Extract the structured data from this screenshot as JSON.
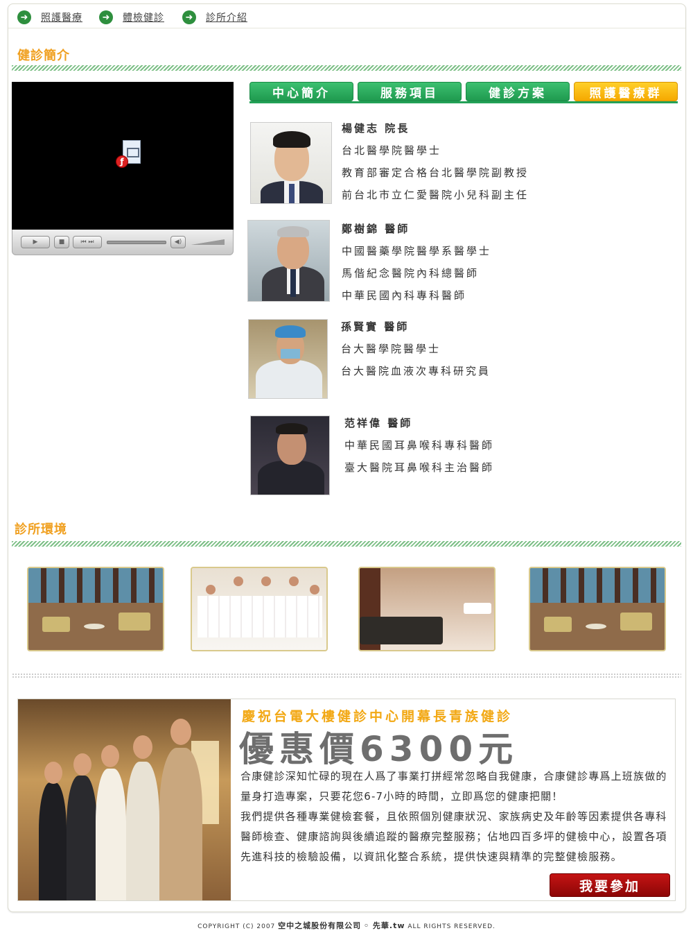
{
  "nav": {
    "items": [
      {
        "label": "照護醫療"
      },
      {
        "label": "體檢健診"
      },
      {
        "label": "診所介紹"
      }
    ]
  },
  "intro": {
    "title": "健診簡介"
  },
  "tabs": [
    {
      "label": "中心簡介"
    },
    {
      "label": "服務項目"
    },
    {
      "label": "健診方案"
    },
    {
      "label": "照護醫療群"
    }
  ],
  "doctors": [
    {
      "name": "楊健志 院長",
      "lines": [
        "台北醫學院醫學士",
        "教育部審定合格台北醫學院副教授",
        "前台北市立仁愛醫院小兒科副主任"
      ]
    },
    {
      "name": "鄭樹錦 醫師",
      "lines": [
        "中國醫藥學院醫學系醫學士",
        "馬偕紀念醫院內科總醫師",
        "中華民國內科專科醫師"
      ]
    },
    {
      "name": "孫賢實 醫師",
      "lines": [
        "台大醫學院醫學士",
        "台大醫院血液次專科研究員"
      ]
    },
    {
      "name": "范祥偉 醫師",
      "lines": [
        "中華民國耳鼻喉科專科醫師",
        "臺大醫院耳鼻喉科主治醫師"
      ]
    }
  ],
  "environment": {
    "title": "診所環境"
  },
  "promo": {
    "subtitle": "慶祝台電大樓健診中心開幕長青族健診",
    "price": "優惠價6300元",
    "paragraph1": "合康健診深知忙碌的現在人爲了事業打拼經常忽略自我健康，合康健診專爲上班族做的量身打造專案，只要花您6-7小時的時間，立即爲您的健康把關！",
    "paragraph2": "我們提供各種專業健檢套餐，且依照個別健康狀況、家族病史及年齡等因素提供各專科醫師檢查、健康諮詢與後續追蹤的醫療完整服務；佔地四百多坪的健檢中心，設置各項先進科技的檢驗設備，以資訊化整合系統，提供快速與精準的完整健檢服務。",
    "button": "我要參加"
  },
  "footer": {
    "prefix": "COPYRIGHT (C) 2007",
    "company": "空中之城股份有限公司",
    "brand": "◦ 先華.tw",
    "suffix": "ALL RIGHTS RESERVED."
  },
  "colors": {
    "section_title": "#f0a020",
    "tab_green": "#23a257",
    "tab_gold": "#f5b400",
    "promo_button": "#a80c0c"
  }
}
